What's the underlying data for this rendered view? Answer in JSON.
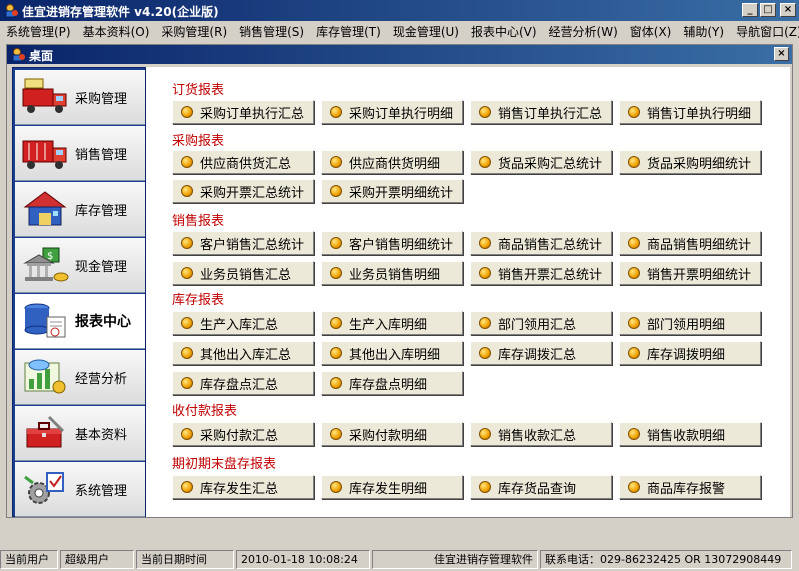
{
  "window": {
    "title": "佳宜进销存管理软件 v4.20(企业版)",
    "buttons": [
      "_",
      "□",
      "×"
    ]
  },
  "menu": [
    "系统管理(P)",
    "基本资料(O)",
    "采购管理(R)",
    "销售管理(S)",
    "库存管理(T)",
    "现金管理(U)",
    "报表中心(V)",
    "经营分析(W)",
    "窗体(X)",
    "辅助(Y)",
    "导航窗口(Z)"
  ],
  "desktop": {
    "title": "桌面",
    "close": "×"
  },
  "sidebar": [
    {
      "label": "采购管理",
      "icon": "purchase-truck-icon"
    },
    {
      "label": "销售管理",
      "icon": "sales-truck-icon"
    },
    {
      "label": "库存管理",
      "icon": "warehouse-icon"
    },
    {
      "label": "现金管理",
      "icon": "cash-bank-icon"
    },
    {
      "label": "报表中心",
      "icon": "report-database-icon",
      "active": true
    },
    {
      "label": "经营分析",
      "icon": "analysis-chart-icon"
    },
    {
      "label": "基本资料",
      "icon": "toolbox-icon"
    },
    {
      "label": "系统管理",
      "icon": "system-gear-icon"
    }
  ],
  "sections": [
    {
      "title": "订货报表",
      "buttons": [
        "采购订单执行汇总",
        "采购订单执行明细",
        "销售订单执行汇总",
        "销售订单执行明细"
      ]
    },
    {
      "title": "采购报表",
      "buttons": [
        "供应商供货汇总",
        "供应商供货明细",
        "货品采购汇总统计",
        "货品采购明细统计",
        "采购开票汇总统计",
        "采购开票明细统计"
      ]
    },
    {
      "title": "销售报表",
      "buttons": [
        "客户销售汇总统计",
        "客户销售明细统计",
        "商品销售汇总统计",
        "商品销售明细统计",
        "业务员销售汇总",
        "业务员销售明细",
        "销售开票汇总统计",
        "销售开票明细统计"
      ]
    },
    {
      "title": "库存报表",
      "buttons": [
        "生产入库汇总",
        "生产入库明细",
        "部门领用汇总",
        "部门领用明细",
        "其他出入库汇总",
        "其他出入库明细",
        "库存调拨汇总",
        "库存调拨明细",
        "库存盘点汇总",
        "库存盘点明细"
      ]
    },
    {
      "title": "收付款报表",
      "buttons": [
        "采购付款汇总",
        "采购付款明细",
        "销售收款汇总",
        "销售收款明细"
      ]
    },
    {
      "title": "期初期末盘存报表",
      "buttons": [
        "库存发生汇总",
        "库存发生明细",
        "库存货品查询",
        "商品库存报警"
      ]
    }
  ],
  "status": {
    "user_label": "当前用户",
    "user": "超级用户",
    "date_label": "当前日期时间",
    "datetime": "2010-01-18 10:08:24",
    "app": "佳宜进销存管理软件",
    "phone": "联系电话：029-86232425 OR 13072908449"
  },
  "colors": {
    "title_bar": "#0a246a",
    "sidebar": "#1b3f8f",
    "section_title": "#c00000"
  }
}
